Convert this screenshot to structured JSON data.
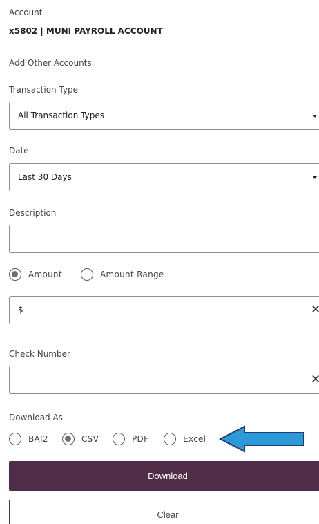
{
  "account": {
    "label": "Account",
    "value": "x5802 | MUNI PAYROLL ACCOUNT",
    "add_link": "Add Other Accounts"
  },
  "transaction_type": {
    "label": "Transaction Type",
    "selected": "All Transaction Types"
  },
  "date": {
    "label": "Date",
    "selected": "Last 30 Days"
  },
  "description": {
    "label": "Description",
    "value": ""
  },
  "amount_mode": {
    "options": [
      "Amount",
      "Amount Range"
    ],
    "selected": "Amount"
  },
  "amount": {
    "prefix": "$",
    "clear_glyph": "✕"
  },
  "check_number": {
    "label": "Check Number",
    "clear_glyph": "✕"
  },
  "download_as": {
    "label": "Download As",
    "options": [
      "BAI2",
      "CSV",
      "PDF",
      "Excel"
    ],
    "selected": "CSV"
  },
  "buttons": {
    "download": "Download",
    "clear": "Clear"
  },
  "annotation": {
    "arrow_color": "#2b9ad6",
    "arrow_outline": "#1f3a78"
  },
  "colors": {
    "primary": "#4f2d48"
  }
}
